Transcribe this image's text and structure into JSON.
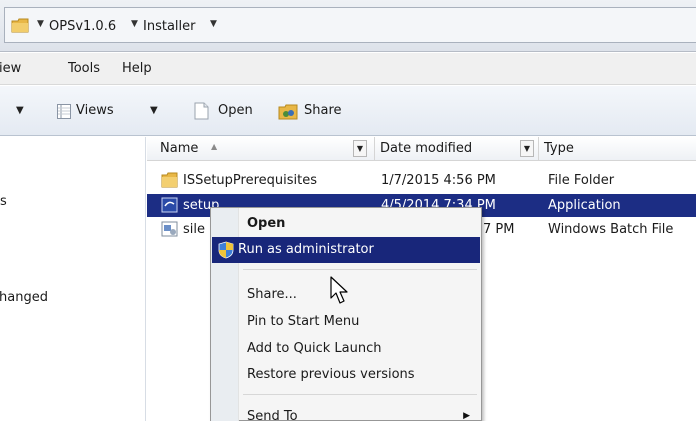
{
  "address": {
    "crumbs": [
      "OPSv1.0.6",
      "Installer"
    ]
  },
  "menu": {
    "items": [
      "View",
      "Tools",
      "Help"
    ],
    "visible_text": [
      "iew",
      "Tools",
      "Help"
    ]
  },
  "toolbar": {
    "views_label": "Views",
    "open_label": "Open",
    "share_label": "Share"
  },
  "nav": {
    "fragment_1": "s",
    "fragment_2": "Changed",
    "fragment_2_visible": "hanged"
  },
  "columns": {
    "name": "Name",
    "date_modified": "Date modified",
    "type": "Type"
  },
  "files": [
    {
      "name": "ISSetupPrerequisites",
      "date": "1/7/2015 4:56 PM",
      "type": "File Folder",
      "icon": "folder-icon",
      "selected": false
    },
    {
      "name": "setup",
      "date": "4/5/2014 7:34 PM",
      "type": "Application",
      "icon": "setup-app-icon",
      "selected": true
    },
    {
      "name": "sile",
      "date": "7 PM",
      "type": "Windows Batch File",
      "icon": "batch-file-icon",
      "selected": false
    }
  ],
  "context_menu": {
    "items": [
      {
        "label": "Open",
        "bold": true
      },
      {
        "label": "Run as administrator",
        "highlighted": true,
        "icon": "uac-shield-icon"
      },
      {
        "label": "Share..."
      },
      {
        "label": "Pin to Start Menu"
      },
      {
        "label": "Add to Quick Launch"
      },
      {
        "label": "Restore previous versions"
      },
      {
        "label": "Send To",
        "submenu": true
      }
    ]
  },
  "colors": {
    "selection": "#1c2d84",
    "menu_highlight": "#18267a",
    "folder": "#e8b746"
  }
}
